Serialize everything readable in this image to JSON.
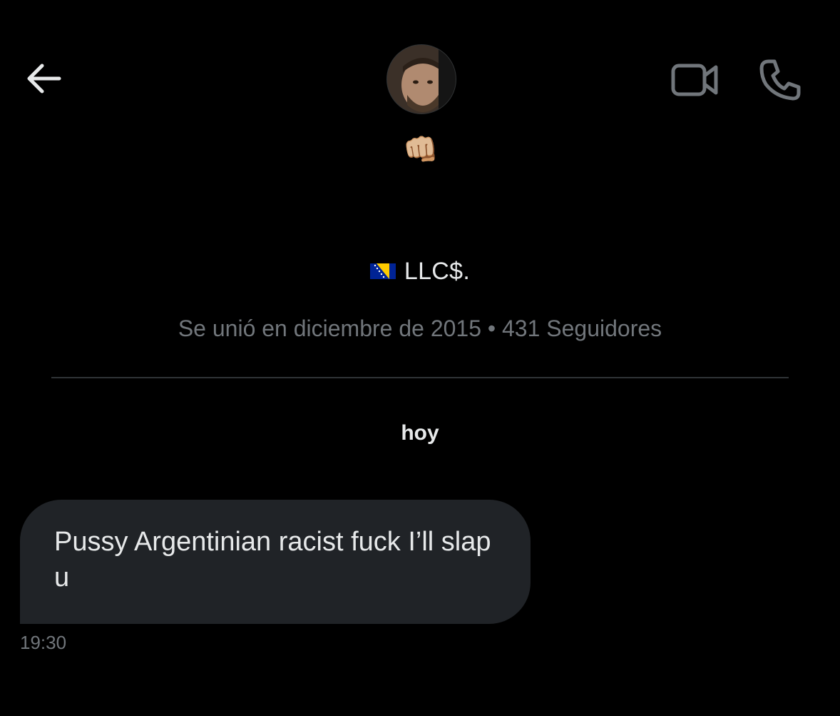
{
  "header": {
    "back_icon": "arrow-left-icon",
    "avatar_icon": "profile-avatar",
    "emoji": "👊🏼",
    "video_icon": "video-call-icon",
    "phone_icon": "phone-call-icon"
  },
  "profile": {
    "flag_icon": "bosnia-flag-icon",
    "name": "LLC$.",
    "meta": "Se unió en diciembre de 2015 • 431 Seguidores"
  },
  "conversation": {
    "date_label": "hoy",
    "messages": [
      {
        "text": "Pussy Argentinian racist fuck I’ll slap u",
        "time": "19:30"
      }
    ]
  },
  "colors": {
    "background": "#000000",
    "bubble": "#202327",
    "primary_text": "#e7e9ea",
    "secondary_text": "#71767b",
    "divider": "#2f3336"
  }
}
